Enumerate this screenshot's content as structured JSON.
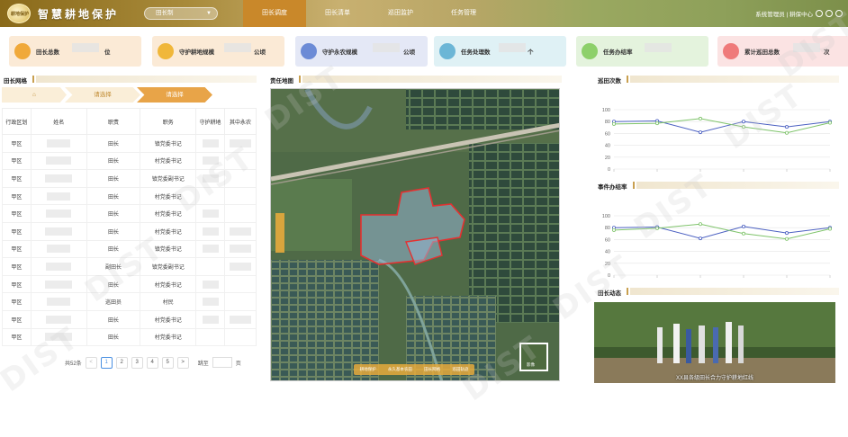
{
  "header": {
    "logo_text": "耕地保护",
    "app_title": "智慧耕地保护",
    "region": "田长制",
    "nav": [
      "田长调度",
      "田长清单",
      "巡田监护",
      "任务管理"
    ],
    "active_nav": 0,
    "user": "系统管理员 | 耕保中心"
  },
  "cards": [
    {
      "label": "田长总数",
      "unit": "位",
      "bg": "#fbead6",
      "icon_bg": "#f0a93a",
      "icon": "user-icon"
    },
    {
      "label": "守护耕地规模",
      "unit": "公顷",
      "bg": "#fbead6",
      "icon_bg": "#f0b73a",
      "icon": "hand-coin-icon"
    },
    {
      "label": "守护永农规模",
      "unit": "公顷",
      "bg": "#e4e8f6",
      "icon_bg": "#6c8bd6",
      "icon": "building-icon"
    },
    {
      "label": "任务处理数",
      "unit": "个",
      "bg": "#dff1f5",
      "icon_bg": "#6cb6d6",
      "icon": "document-icon"
    },
    {
      "label": "任务办结率",
      "unit": "",
      "bg": "#e4f3dd",
      "icon_bg": "#8dd06a",
      "icon": "thumb-icon"
    },
    {
      "label": "累计巡田总数",
      "unit": "次",
      "bg": "#fbe3e3",
      "icon_bg": "#ef7a7a",
      "icon": "clipboard-icon"
    }
  ],
  "grid_section": {
    "title": "田长网格"
  },
  "breadcrumb": {
    "level1": "请选择",
    "level2": "请选择"
  },
  "table": {
    "headers": [
      "行政区划",
      "姓名",
      "职责",
      "职务",
      "守护耕地",
      "其中永农"
    ],
    "rows": [
      {
        "district": "甲区",
        "duty": "田长",
        "position": "镇党委书记"
      },
      {
        "district": "甲区",
        "duty": "田长",
        "position": "村党委书记"
      },
      {
        "district": "甲区",
        "duty": "田长",
        "position": "镇党委副书记"
      },
      {
        "district": "甲区",
        "duty": "田长",
        "position": "村党委书记"
      },
      {
        "district": "甲区",
        "duty": "田长",
        "position": "村党委书记"
      },
      {
        "district": "甲区",
        "duty": "田长",
        "position": "村党委书记"
      },
      {
        "district": "甲区",
        "duty": "田长",
        "position": "镇党委书记"
      },
      {
        "district": "甲区",
        "duty": "副田长",
        "position": "镇党委副书记"
      },
      {
        "district": "甲区",
        "duty": "田长",
        "position": "村党委书记"
      },
      {
        "district": "甲区",
        "duty": "巡田员",
        "position": "村民"
      },
      {
        "district": "甲区",
        "duty": "田长",
        "position": "村党委书记"
      },
      {
        "district": "甲区",
        "duty": "田长",
        "position": "村党委书记"
      }
    ]
  },
  "pager": {
    "total": "共52条",
    "pages": [
      "1",
      "2",
      "3",
      "4",
      "5"
    ],
    "prev": "<",
    "next": ">",
    "jump_label": "跳至",
    "page_suffix": "页"
  },
  "map_section": {
    "title": "责任地图",
    "toolbar": [
      "耕地保护",
      "永久基本农田",
      "田长网格",
      "巡田轨迹"
    ],
    "mini_map_label": "影像"
  },
  "chart_patrol": {
    "title": "巡田次数"
  },
  "chart_tasks": {
    "title": "事件办结率"
  },
  "news": {
    "title": "田长动态",
    "caption": "XX县各级田长合力守护耕地红线"
  },
  "watermark": "DIST",
  "chart_data": [
    {
      "type": "line",
      "title": "巡田次数",
      "x": [
        1,
        2,
        3,
        4,
        5,
        6
      ],
      "ylim": [
        0,
        100
      ],
      "yticks": [
        0,
        20,
        40,
        60,
        80,
        100
      ],
      "grid": true,
      "series": [
        {
          "color": "#4a5fc1",
          "values": [
            80,
            81,
            62,
            80,
            71,
            80
          ]
        },
        {
          "color": "#7ec36a",
          "values": [
            76,
            77,
            85,
            71,
            61,
            78
          ]
        }
      ]
    },
    {
      "type": "line",
      "title": "事件办结率",
      "x": [
        1,
        2,
        3,
        4,
        5,
        6
      ],
      "ylim": [
        0,
        100
      ],
      "yticks": [
        0,
        20,
        40,
        60,
        80,
        100
      ],
      "grid": true,
      "series": [
        {
          "color": "#4a5fc1",
          "values": [
            80,
            81,
            62,
            82,
            71,
            80
          ]
        },
        {
          "color": "#7ec36a",
          "values": [
            76,
            79,
            86,
            70,
            61,
            78
          ]
        }
      ]
    }
  ]
}
